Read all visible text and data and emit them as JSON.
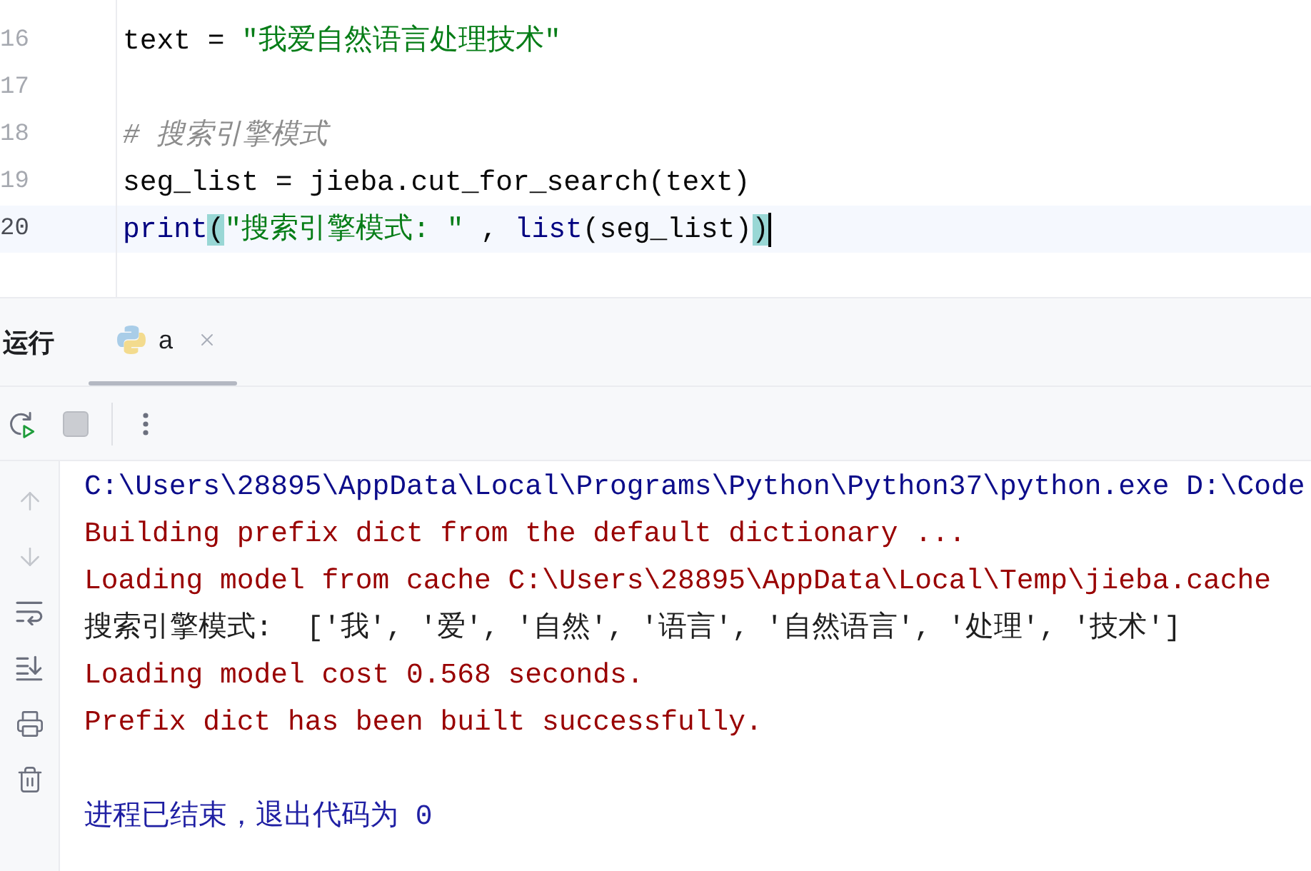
{
  "editor": {
    "lines": [
      {
        "number": "16",
        "current": false,
        "tokens": [
          {
            "text": "text = ",
            "kind": "plain"
          },
          {
            "text": "\"我爱自然语言处理技术\"",
            "kind": "string"
          }
        ]
      },
      {
        "number": "17",
        "current": false
      },
      {
        "number": "18",
        "current": false,
        "tokens": [
          {
            "text": "# 搜索引擎模式",
            "kind": "comment"
          }
        ]
      },
      {
        "number": "19",
        "current": false,
        "tokens": [
          {
            "text": "seg_list = jieba.cut_for_search(text)",
            "kind": "plain"
          }
        ]
      },
      {
        "number": "20",
        "current": true,
        "tokens": [
          {
            "text": "print",
            "kind": "builtin"
          },
          {
            "text": "(",
            "kind": "bracket_match"
          },
          {
            "text": "\"搜索引擎模式: \"",
            "kind": "string"
          },
          {
            "text": " , ",
            "kind": "plain"
          },
          {
            "text": "list",
            "kind": "builtin"
          },
          {
            "text": "(seg_list)",
            "kind": "plain"
          },
          {
            "text": ")",
            "kind": "bracket_match"
          }
        ]
      }
    ]
  },
  "run_panel": {
    "title": "运行",
    "tabs": [
      {
        "label": "a",
        "selected": true
      }
    ],
    "toolbar": {
      "stop": {
        "disabled": true
      }
    },
    "console_tools": {
      "scroll_up": {
        "disabled": true
      },
      "scroll_down": {
        "disabled": true
      }
    },
    "console": [
      {
        "kind": "command",
        "text": "C:\\Users\\28895\\AppData\\Local\\Programs\\Python\\Python37\\python.exe D:\\Code"
      },
      {
        "kind": "stderr",
        "text": "Building prefix dict from the default dictionary ..."
      },
      {
        "kind": "stderr",
        "text": "Loading model from cache C:\\Users\\28895\\AppData\\Local\\Temp\\jieba.cache"
      },
      {
        "kind": "stdout",
        "text": "搜索引擎模式:  ['我', '爱', '自然', '语言', '自然语言', '处理', '技术']"
      },
      {
        "kind": "stderr",
        "text": "Loading model cost 0.568 seconds."
      },
      {
        "kind": "stderr",
        "text": "Prefix dict has been built successfully."
      },
      {
        "kind": "exit",
        "text": "进程已结束，退出代码为 0"
      }
    ]
  }
}
